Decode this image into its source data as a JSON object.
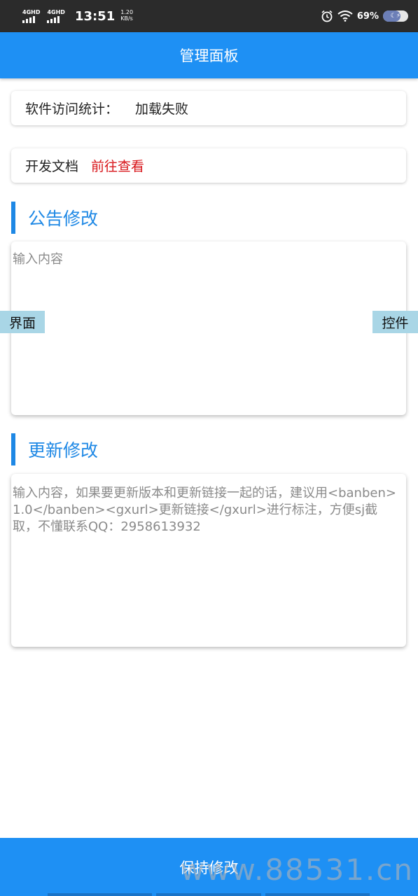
{
  "status_bar": {
    "sim1": "4GHD",
    "sim2": "4GHD",
    "time": "13:51",
    "speed_value": "1.20",
    "speed_unit": "KB/s",
    "battery_percent": "69%",
    "icons": [
      "signal-icon",
      "alarm-icon",
      "wifi-icon",
      "battery-icon"
    ]
  },
  "app_bar": {
    "title": "管理面板"
  },
  "stats": {
    "label": "软件访问统计：",
    "value": "加载失败"
  },
  "docs": {
    "label": "开发文档",
    "link": "前往查看"
  },
  "announcement": {
    "title": "公告修改",
    "placeholder": "输入内容"
  },
  "update": {
    "title": "更新修改",
    "placeholder": "输入内容，如果要更新版本和更新链接一起的话，建议用<banben>1.0</banben><gxurl>更新链接</gxurl>进行标注，方便sj截取，不懂联系QQ：2958613932"
  },
  "side_tabs": {
    "left": "界面",
    "right": "控件"
  },
  "save_button": {
    "label": "保持修改"
  },
  "watermark": "www.88531.cn",
  "colors": {
    "primary": "#1e90f4",
    "link_red": "#d8161b",
    "side_tab": "#a9d6e6"
  }
}
